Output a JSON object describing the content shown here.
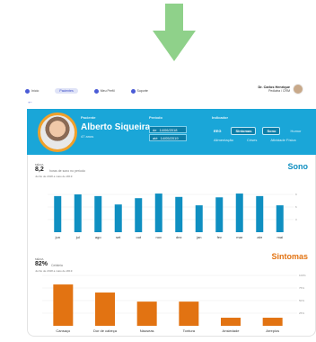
{
  "colors": {
    "accent_green": "#8fd18a",
    "header_blue": "#1aa6d8",
    "sono_bar": "#0f8fc1",
    "sintomas_bar": "#e27312",
    "sintomas_title": "#e27312",
    "sono_title": "#0f8fc1"
  },
  "nav": {
    "items": [
      {
        "label": "Início",
        "icon": "home-icon"
      },
      {
        "label": "Pacientes",
        "icon": "patients-icon",
        "active": true
      },
      {
        "label": "Meu Perfil",
        "icon": "profile-icon"
      },
      {
        "label": "Suporte",
        "icon": "support-icon"
      }
    ],
    "user_name": "Dr. Carlos Henrique",
    "user_role": "Pediatra / CRM"
  },
  "patient": {
    "section_label": "Paciente",
    "name": "Alberto Siqueira",
    "age": "47 anos",
    "period_label": "Período",
    "date_from_prefix": "de",
    "date_from": "14/06/2018",
    "date_to_prefix": "até",
    "date_to": "14/05/2019",
    "indicator_label": "Indicador",
    "indicators_row1": [
      "EEG",
      "Sintomas",
      "Sono",
      "Humor"
    ],
    "indicators_row2": [
      "Alimentação",
      "Crises",
      "Atividade Física"
    ],
    "active_indicators": [
      "Sintomas",
      "Sono"
    ]
  },
  "sono": {
    "metric_label": "MÉDIA",
    "metric_value": "8,2",
    "metric_unit": "horas de sono no período",
    "metric_range": "Junho de 2018 a maio de 2019"
  },
  "sintomas": {
    "metric_label": "MÉDIA",
    "metric_value": "82%",
    "metric_unit": "Cefaleia",
    "metric_range": "Junho de 2018 a maio de 2019"
  },
  "chart_data": [
    {
      "type": "bar",
      "title": "Sono",
      "categories": [
        "jun",
        "jul",
        "ago",
        "set",
        "out",
        "nov",
        "dez",
        "jan",
        "fev",
        "mar",
        "abr",
        "mai"
      ],
      "values": [
        8.6,
        9.0,
        8.6,
        6.6,
        8.1,
        9.2,
        8.4,
        6.4,
        8.3,
        9.2,
        8.6,
        6.4
      ],
      "yticks": [
        "9",
        "6",
        "3"
      ],
      "ylim": [
        0,
        12
      ]
    },
    {
      "type": "bar",
      "title": "Sintomas",
      "categories": [
        "Cansaço",
        "Dor de cabeça",
        "Náuseas",
        "Tontura",
        "Ansiedade",
        "Arrepios"
      ],
      "values": [
        82,
        66,
        48,
        48,
        16,
        16
      ],
      "yticks": [
        "100%",
        "75%",
        "50%",
        "25%"
      ],
      "ylim": [
        0,
        100
      ]
    }
  ]
}
